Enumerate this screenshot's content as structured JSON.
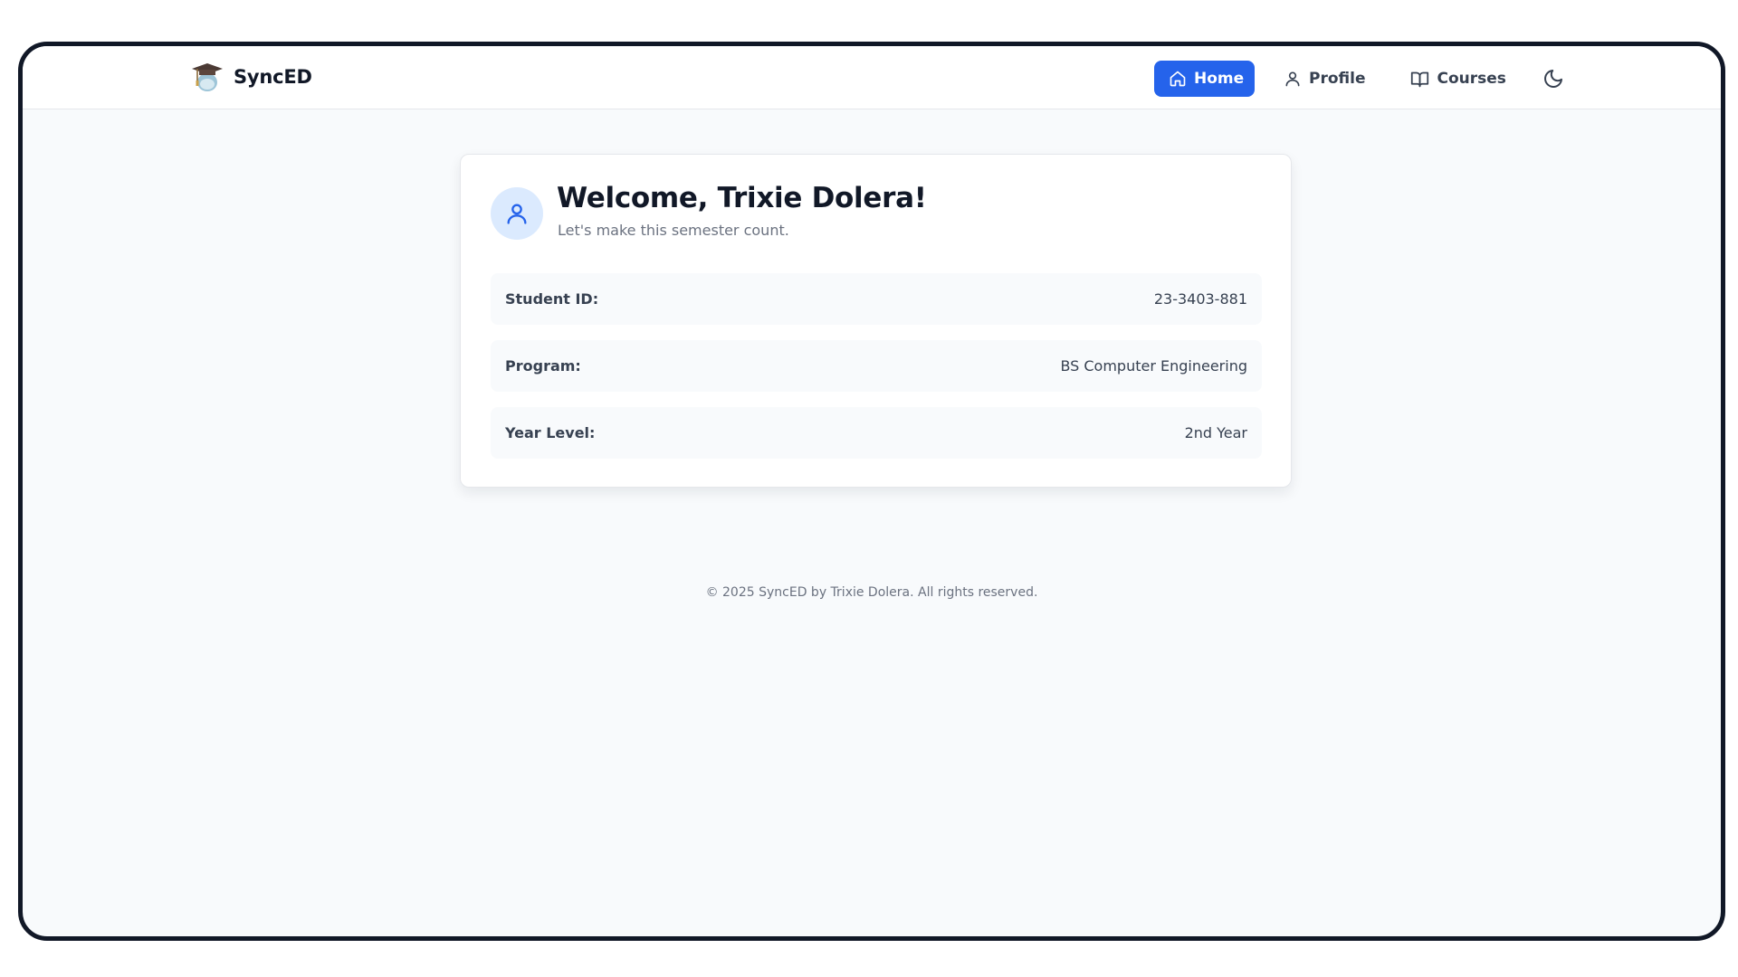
{
  "brand": {
    "name": "SyncED",
    "logo_icon": "graduation-cap-icon"
  },
  "nav": {
    "items": [
      {
        "label": "Home",
        "icon": "home-icon",
        "active": true
      },
      {
        "label": "Profile",
        "icon": "user-icon",
        "active": false
      },
      {
        "label": "Courses",
        "icon": "book-open-icon",
        "active": false
      }
    ],
    "theme_toggle_icon": "moon-icon"
  },
  "welcome": {
    "title": "Welcome, Trixie Dolera!",
    "subtitle": "Let's make this semester count.",
    "avatar_icon": "user-icon"
  },
  "info": [
    {
      "label": "Student ID:",
      "value": "23-3403-881"
    },
    {
      "label": "Program:",
      "value": "BS Computer Engineering"
    },
    {
      "label": "Year Level:",
      "value": "2nd Year"
    }
  ],
  "footer": {
    "text": "© 2025 SyncED by Trixie Dolera. All rights reserved."
  },
  "colors": {
    "accent": "#2563eb",
    "page_background": "#f8fafc",
    "frame_border": "#111827",
    "avatar_background": "#dbeafe"
  }
}
